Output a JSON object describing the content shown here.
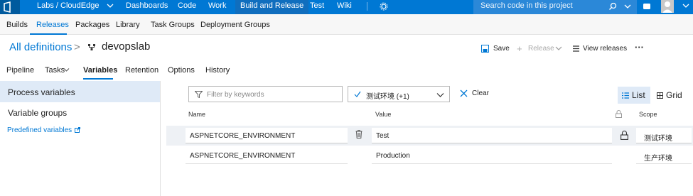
{
  "topbar": {
    "org": "Labs / CloudEdge",
    "nav": [
      "Dashboards",
      "Code",
      "Work",
      "Build and Release",
      "Test",
      "Wiki"
    ],
    "search_placeholder": "Search code in this project"
  },
  "subnav": [
    "Builds",
    "Releases",
    "Packages",
    "Library",
    "Task Groups",
    "Deployment Groups"
  ],
  "breadcrumb": {
    "root": "All definitions",
    "separator": ">",
    "current": "devopslab"
  },
  "actions": {
    "save": "Save",
    "release": "Release",
    "view_releases": "View releases",
    "more": "···"
  },
  "tabs": [
    "Pipeline",
    "Tasks",
    "Variables",
    "Retention",
    "Options",
    "History"
  ],
  "sidebar": {
    "process_variables": "Process variables",
    "variable_groups": "Variable groups",
    "predefined_variables": "Predefined variables"
  },
  "filter": {
    "placeholder": "Filter by keywords",
    "scope_selected": "测试环境 (+1)",
    "clear": "Clear",
    "list": "List",
    "grid": "Grid"
  },
  "table": {
    "headers": {
      "name": "Name",
      "value": "Value",
      "scope": "Scope"
    },
    "rows": [
      {
        "name": "ASPNETCORE_ENVIRONMENT",
        "value": "Test",
        "scope": "测试环境"
      },
      {
        "name": "ASPNETCORE_ENVIRONMENT",
        "value": "Production",
        "scope": "生产环境"
      }
    ]
  },
  "colors": {
    "accent": "#0078d4",
    "selected_bg": "#dfeaf7"
  },
  "icons": [
    "azure-devops-logo",
    "chevron-down-icon",
    "settings-icon",
    "search-icon",
    "notifications-icon",
    "user-avatar",
    "release-definition-icon",
    "save-icon",
    "plus-icon",
    "view-releases-icon",
    "more-icon",
    "external-link-icon",
    "filter-icon",
    "check-icon",
    "close-icon",
    "list-icon",
    "grid-icon",
    "lock-icon",
    "delete-icon"
  ]
}
